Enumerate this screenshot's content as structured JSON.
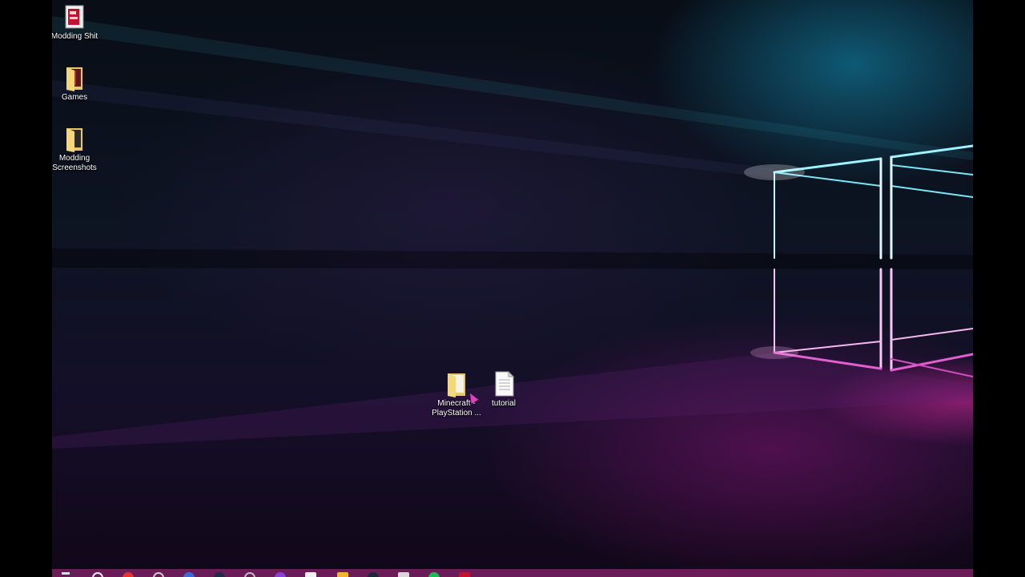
{
  "desktop": {
    "icons": [
      {
        "label": "Modding Shit",
        "icon": "winrar-archive-icon"
      },
      {
        "label": "Games",
        "icon": "folder-icon"
      },
      {
        "label": "Modding Screenshots",
        "icon": "folder-icon"
      },
      {
        "label": "Minecraft - PlayStation ...",
        "icon": "folder-icon"
      },
      {
        "label": "tutorial",
        "icon": "text-document-icon"
      }
    ]
  },
  "taskbar": {
    "background": "#6a1b58",
    "pinned_icons": [
      "start-icon",
      "search-icon",
      "opera-icon",
      "task-view-icon",
      "chrome-icon",
      "edge-icon",
      "cortana-icon",
      "firefox-icon",
      "store-icon",
      "file-explorer-icon",
      "steam-icon",
      "notepad-icon",
      "spotify-icon",
      "winrar-icon"
    ]
  },
  "colors": {
    "wallpaper_cyan": "#40d8f0",
    "wallpaper_magenta": "#e040c0",
    "folder_yellow": "#f3d77a"
  }
}
